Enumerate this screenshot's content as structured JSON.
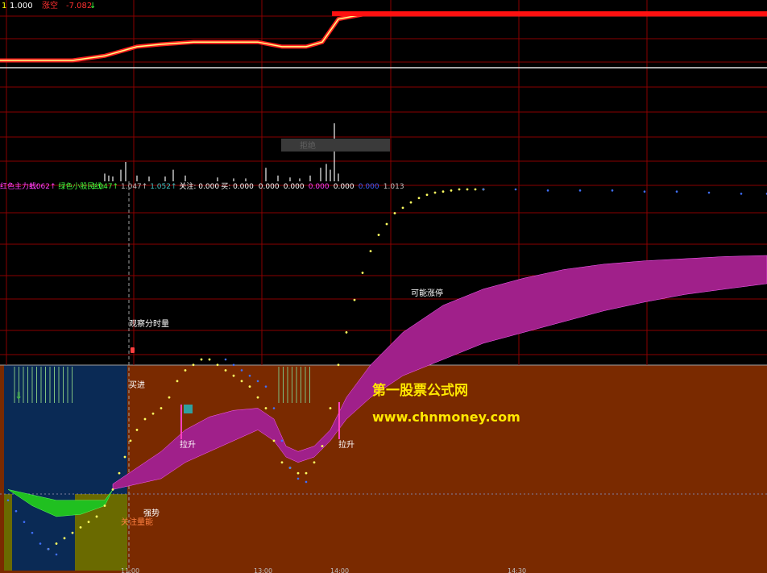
{
  "top_panel": {
    "label_prefix": "1",
    "label_value": "1.000",
    "label_name": "涨空",
    "label_value2": "-7.082",
    "label_arrow": "↓"
  },
  "volume_panel": {
    "tooltip": "拒绝"
  },
  "indicator_header": {
    "items": [
      {
        "text": "红色主力线:",
        "color": "#ff40ff"
      },
      {
        "text": "1.062↑",
        "color": "#ff40ff"
      },
      {
        "text": "绿色小股民线:",
        "color": "#40ff40"
      },
      {
        "text": "1.047↑",
        "color": "#40ff40"
      },
      {
        "text": "1.047↑",
        "color": "#c0c0c0"
      },
      {
        "text": "1.052↑",
        "color": "#40c0c0"
      },
      {
        "text": "关注: 0.000",
        "color": "#ffffff"
      },
      {
        "text": "买: 0.000",
        "color": "#ffffff"
      },
      {
        "text": "0.000",
        "color": "#ffffff"
      },
      {
        "text": "0.000",
        "color": "#ffffff"
      },
      {
        "text": "0.000",
        "color": "#ff40ff"
      },
      {
        "text": "0.000",
        "color": "#ffffff"
      },
      {
        "text": "0.000",
        "color": "#4060ff"
      },
      {
        "text": "1.013",
        "color": "#c0c0c0"
      }
    ]
  },
  "annotations": {
    "observe": "观察分时量",
    "buy_in": "买进",
    "pull_up_1": "拉升",
    "pull_up_2": "拉升",
    "strong": "强势",
    "focus_volume": "关注量能",
    "limit_up": "可能涨停"
  },
  "watermark": {
    "title": "第一股票公式网",
    "url": "www.chnmoney.com"
  },
  "colors": {
    "grid": "#8a0000",
    "ribbon": "#a0208a",
    "green_ribbon": "#20c020",
    "bg_brown": "#7a2a00",
    "bg_blue": "#0a2a55",
    "bg_olive": "#6a6a00",
    "dot_yellow": "#ffff60",
    "dot_blue": "#4070ff",
    "watermark": "#ffe800"
  },
  "chart_data": {
    "type": "line",
    "x_ticks": [
      "11:00",
      "13:00",
      "14:00",
      "14:30"
    ],
    "price_line": {
      "x": [
        0,
        30,
        60,
        90,
        130,
        150,
        170,
        200,
        240,
        290,
        320,
        350,
        380,
        400,
        420,
        450,
        500,
        600,
        700,
        800,
        952
      ],
      "y": [
        1.0,
        1.0,
        1.0,
        1.0,
        1.01,
        1.02,
        1.03,
        1.035,
        1.04,
        1.04,
        1.04,
        1.03,
        1.03,
        1.04,
        1.09,
        1.1,
        1.1,
        1.1,
        1.1,
        1.1,
        1.1
      ]
    },
    "volume_bars": [
      {
        "x": 130,
        "v": 8
      },
      {
        "x": 135,
        "v": 6
      },
      {
        "x": 140,
        "v": 5
      },
      {
        "x": 150,
        "v": 12
      },
      {
        "x": 156,
        "v": 20
      },
      {
        "x": 170,
        "v": 6
      },
      {
        "x": 185,
        "v": 5
      },
      {
        "x": 205,
        "v": 5
      },
      {
        "x": 215,
        "v": 12
      },
      {
        "x": 230,
        "v": 6
      },
      {
        "x": 270,
        "v": 4
      },
      {
        "x": 290,
        "v": 3
      },
      {
        "x": 305,
        "v": 3
      },
      {
        "x": 330,
        "v": 14
      },
      {
        "x": 345,
        "v": 6
      },
      {
        "x": 360,
        "v": 4
      },
      {
        "x": 372,
        "v": 3
      },
      {
        "x": 385,
        "v": 6
      },
      {
        "x": 398,
        "v": 14
      },
      {
        "x": 405,
        "v": 18
      },
      {
        "x": 410,
        "v": 12
      },
      {
        "x": 415,
        "v": 60
      },
      {
        "x": 420,
        "v": 8
      }
    ],
    "ribbon_upper": {
      "x": [
        140,
        170,
        200,
        230,
        260,
        290,
        320,
        340,
        355,
        370,
        390,
        410,
        430,
        460,
        500,
        550,
        600,
        650,
        700,
        750,
        800,
        850,
        900,
        952
      ],
      "y": [
        0.96,
        0.975,
        0.99,
        1.01,
        1.022,
        1.028,
        1.03,
        1.02,
        0.995,
        0.99,
        0.995,
        1.01,
        1.04,
        1.07,
        1.1,
        1.125,
        1.14,
        1.15,
        1.158,
        1.163,
        1.166,
        1.168,
        1.17,
        1.171
      ]
    },
    "ribbon_lower": {
      "x": [
        140,
        170,
        200,
        230,
        260,
        290,
        320,
        340,
        355,
        370,
        390,
        410,
        430,
        460,
        500,
        550,
        600,
        650,
        700,
        750,
        800,
        850,
        900,
        952
      ],
      "y": [
        0.955,
        0.96,
        0.965,
        0.98,
        0.99,
        1.0,
        1.01,
        1.0,
        0.985,
        0.98,
        0.985,
        1.0,
        1.02,
        1.04,
        1.06,
        1.075,
        1.09,
        1.1,
        1.11,
        1.12,
        1.128,
        1.135,
        1.14,
        1.145
      ]
    },
    "green_upper": {
      "x": [
        10,
        40,
        70,
        100,
        130,
        140
      ],
      "y": [
        0.955,
        0.95,
        0.945,
        0.945,
        0.945,
        0.955
      ]
    },
    "green_lower": {
      "x": [
        10,
        40,
        70,
        100,
        130,
        140
      ],
      "y": [
        0.955,
        0.94,
        0.93,
        0.932,
        0.94,
        0.955
      ]
    },
    "yellow_dots": {
      "x": [
        60,
        70,
        80,
        90,
        100,
        110,
        120,
        130,
        140,
        148,
        155,
        162,
        170,
        180,
        190,
        200,
        210,
        220,
        230,
        240,
        250,
        260,
        270,
        280,
        290,
        300,
        310,
        320,
        330,
        340,
        350,
        360,
        370,
        380,
        390,
        400,
        410,
        420,
        430,
        440,
        450,
        460,
        470,
        480,
        490,
        500,
        510,
        520,
        530,
        540,
        550,
        560,
        570,
        580,
        590,
        600
      ],
      "y": [
        0.9,
        0.905,
        0.91,
        0.915,
        0.92,
        0.925,
        0.93,
        0.94,
        0.955,
        0.97,
        0.985,
        1.0,
        1.01,
        1.02,
        1.025,
        1.03,
        1.04,
        1.055,
        1.065,
        1.07,
        1.075,
        1.075,
        1.07,
        1.065,
        1.06,
        1.055,
        1.05,
        1.04,
        1.03,
        1.0,
        0.98,
        0.975,
        0.97,
        0.97,
        0.98,
        0.995,
        1.03,
        1.07,
        1.1,
        1.13,
        1.155,
        1.175,
        1.19,
        1.2,
        1.21,
        1.215,
        1.22,
        1.224,
        1.227,
        1.229,
        1.23,
        1.231,
        1.232,
        1.232,
        1.232,
        1.232
      ]
    },
    "blue_dots": {
      "x": [
        10,
        20,
        30,
        40,
        50,
        60,
        70,
        280,
        290,
        300,
        310,
        320,
        330,
        340,
        350,
        360,
        370,
        380,
        600,
        640,
        680,
        720,
        760,
        800,
        840,
        880,
        920,
        952
      ],
      "y": [
        0.945,
        0.935,
        0.925,
        0.915,
        0.905,
        0.9,
        0.895,
        1.075,
        1.07,
        1.065,
        1.06,
        1.055,
        1.05,
        1.03,
        1.0,
        0.975,
        0.965,
        0.962,
        1.232,
        1.232,
        1.231,
        1.231,
        1.231,
        1.23,
        1.23,
        1.229,
        1.228,
        1.228
      ]
    }
  }
}
